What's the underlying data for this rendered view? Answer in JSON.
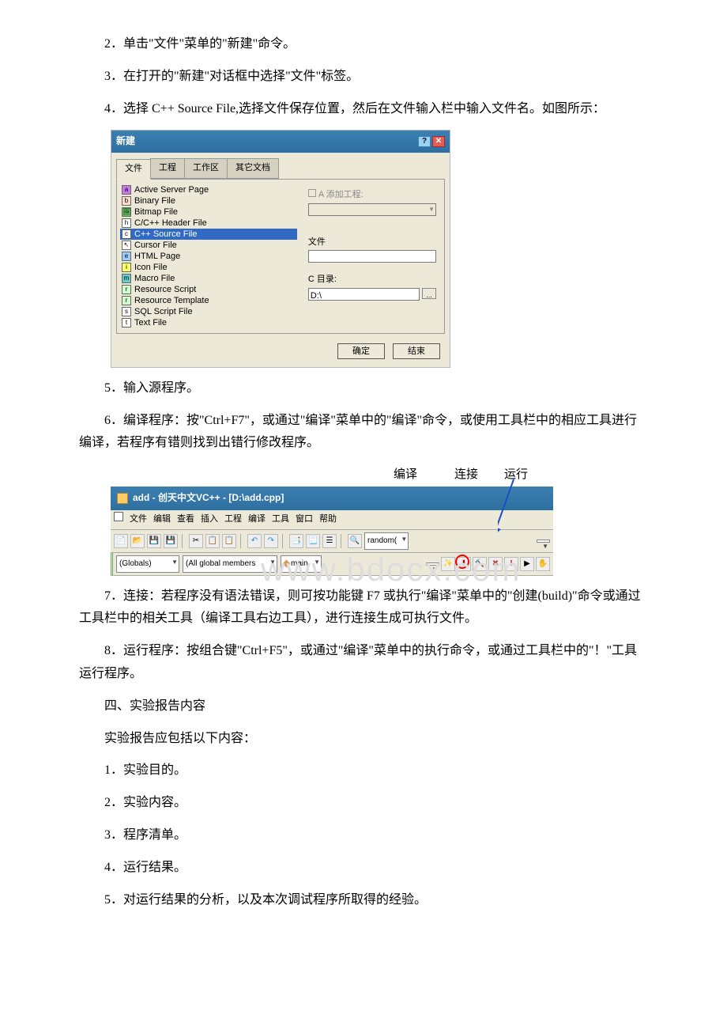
{
  "paragraphs": {
    "p2": "2．单击\"文件\"菜单的\"新建\"命令。",
    "p3": "3．在打开的\"新建\"对话框中选择\"文件\"标签。",
    "p4": "4．选择 C++ Source File,选择文件保存位置，然后在文件输入栏中输入文件名。如图所示：",
    "p5": "5．输入源程序。",
    "p6": "6．编译程序：按\"Ctrl+F7\"，或通过\"编译\"菜单中的\"编译\"命令，或使用工具栏中的相应工具进行编译，若程序有错则找到出错行修改程序。",
    "p7": "7．连接：若程序没有语法错误，则可按功能键 F7 或执行\"编译\"菜单中的\"创建(build)\"命令或通过工具栏中的相关工具（编译工具右边工具），进行连接生成可执行文件。",
    "p8": "8．运行程序：按组合键\"Ctrl+F5\"，或通过\"编译\"菜单中的执行命令，或通过工具栏中的\"！\"工具运行程序。",
    "h4": "四、实验报告内容",
    "p_intro": "实验报告应包括以下内容：",
    "li1": "1．实验目的。",
    "li2": "2．实验内容。",
    "li3": "3．程序清单。",
    "li4": "4．运行结果。",
    "li5": "5．对运行结果的分析，以及本次调试程序所取得的经验。"
  },
  "dialog": {
    "title": "新建",
    "tabs": [
      "文件",
      "工程",
      "工作区",
      "其它文档"
    ],
    "file_types": [
      "Active Server Page",
      "Binary File",
      "Bitmap File",
      "C/C++ Header File",
      "C++ Source File",
      "Cursor File",
      "HTML Page",
      "Icon File",
      "Macro File",
      "Resource Script",
      "Resource Template",
      "SQL Script File",
      "Text File"
    ],
    "add_to_project": "A 添加工程:",
    "file_label": "文件",
    "dir_label": "C 目录:",
    "dir_value": "D:\\",
    "ok": "确定",
    "cancel": "结束"
  },
  "annotations": {
    "compile": "编译",
    "link": "连接",
    "run": "运行"
  },
  "vc": {
    "title": "add - 创天中文VC++ - [D:\\add.cpp]",
    "menu": [
      "文件",
      "编辑",
      "查看",
      "插入",
      "工程",
      "编译",
      "工具",
      "窗口",
      "帮助"
    ],
    "search_text": "random(",
    "globals": "(Globals)",
    "members": "(All global members",
    "main": "main"
  },
  "watermark": "www.bdocx.com"
}
